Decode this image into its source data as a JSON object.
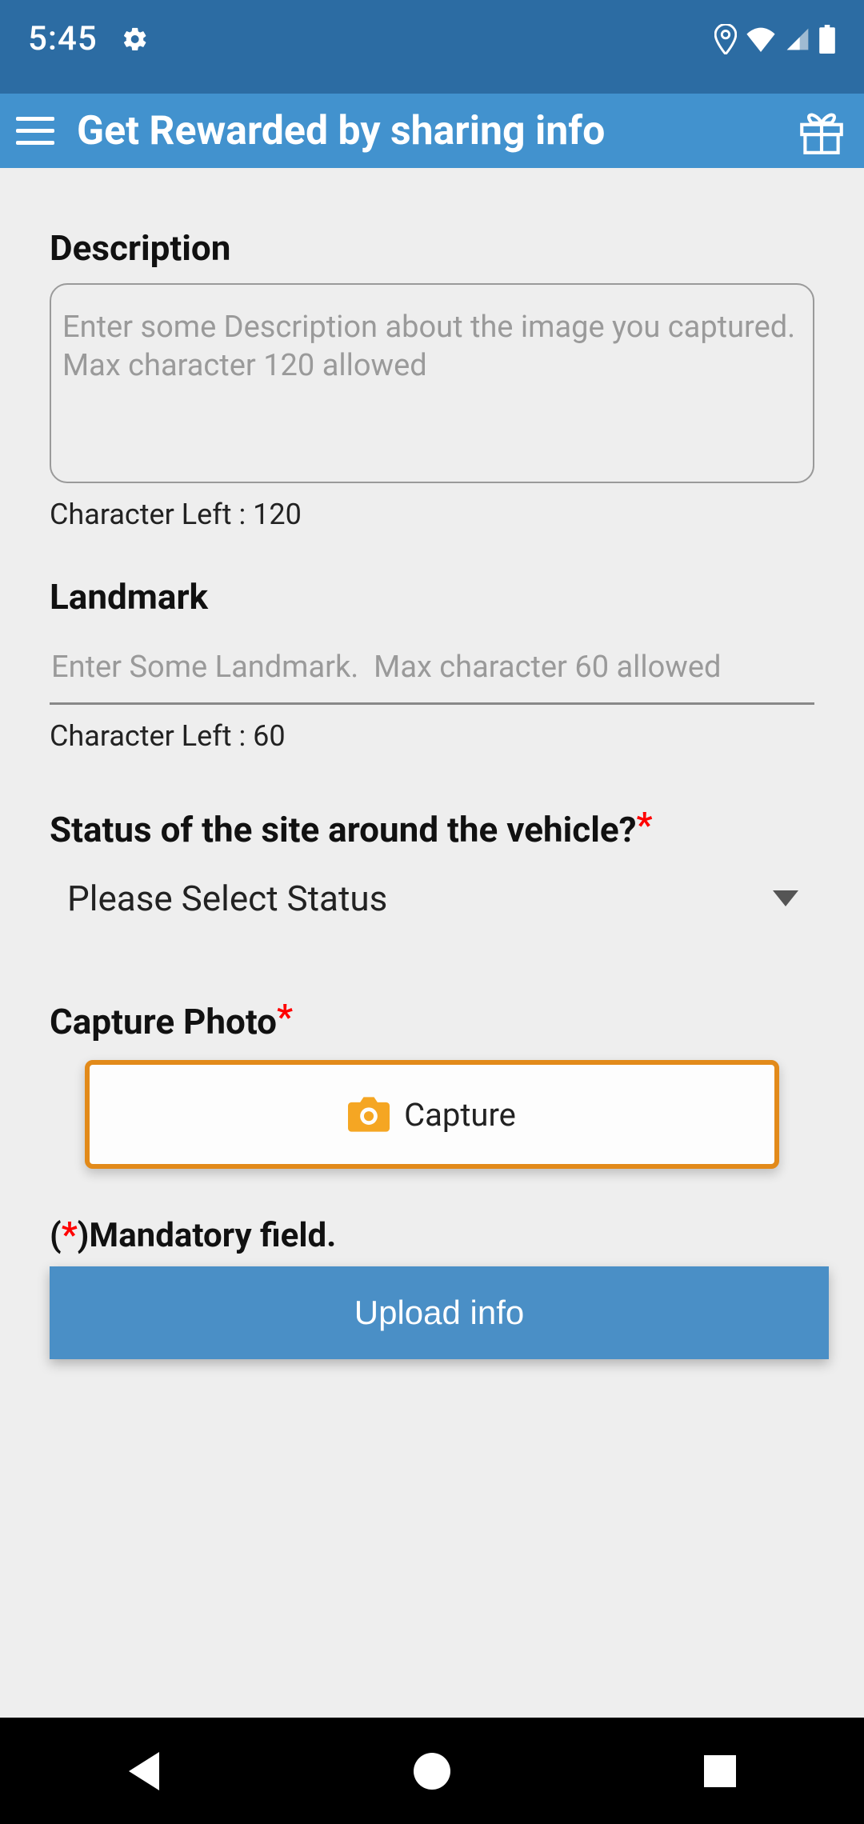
{
  "status_bar": {
    "time": "5:45"
  },
  "app_bar": {
    "title": "Get Rewarded by sharing info"
  },
  "description": {
    "label": "Description",
    "placeholder": "Enter some Description about the image you captured. Max character 120 allowed",
    "value": "",
    "char_left_text": "Character Left : 120",
    "max_chars": 120
  },
  "landmark": {
    "label": "Landmark",
    "placeholder": "Enter Some Landmark.  Max character 60 allowed",
    "value": "",
    "char_left_text": "Character Left : 60",
    "max_chars": 60
  },
  "site_status": {
    "label": "Status of the site around the vehicle?",
    "selected": "Please Select Status"
  },
  "capture_photo": {
    "label": "Capture Photo",
    "button_label": "Capture"
  },
  "mandatory_note_prefix": "(",
  "mandatory_note_star": "*",
  "mandatory_note_suffix": ")Mandatory field.",
  "upload_button_label": "Upload info"
}
